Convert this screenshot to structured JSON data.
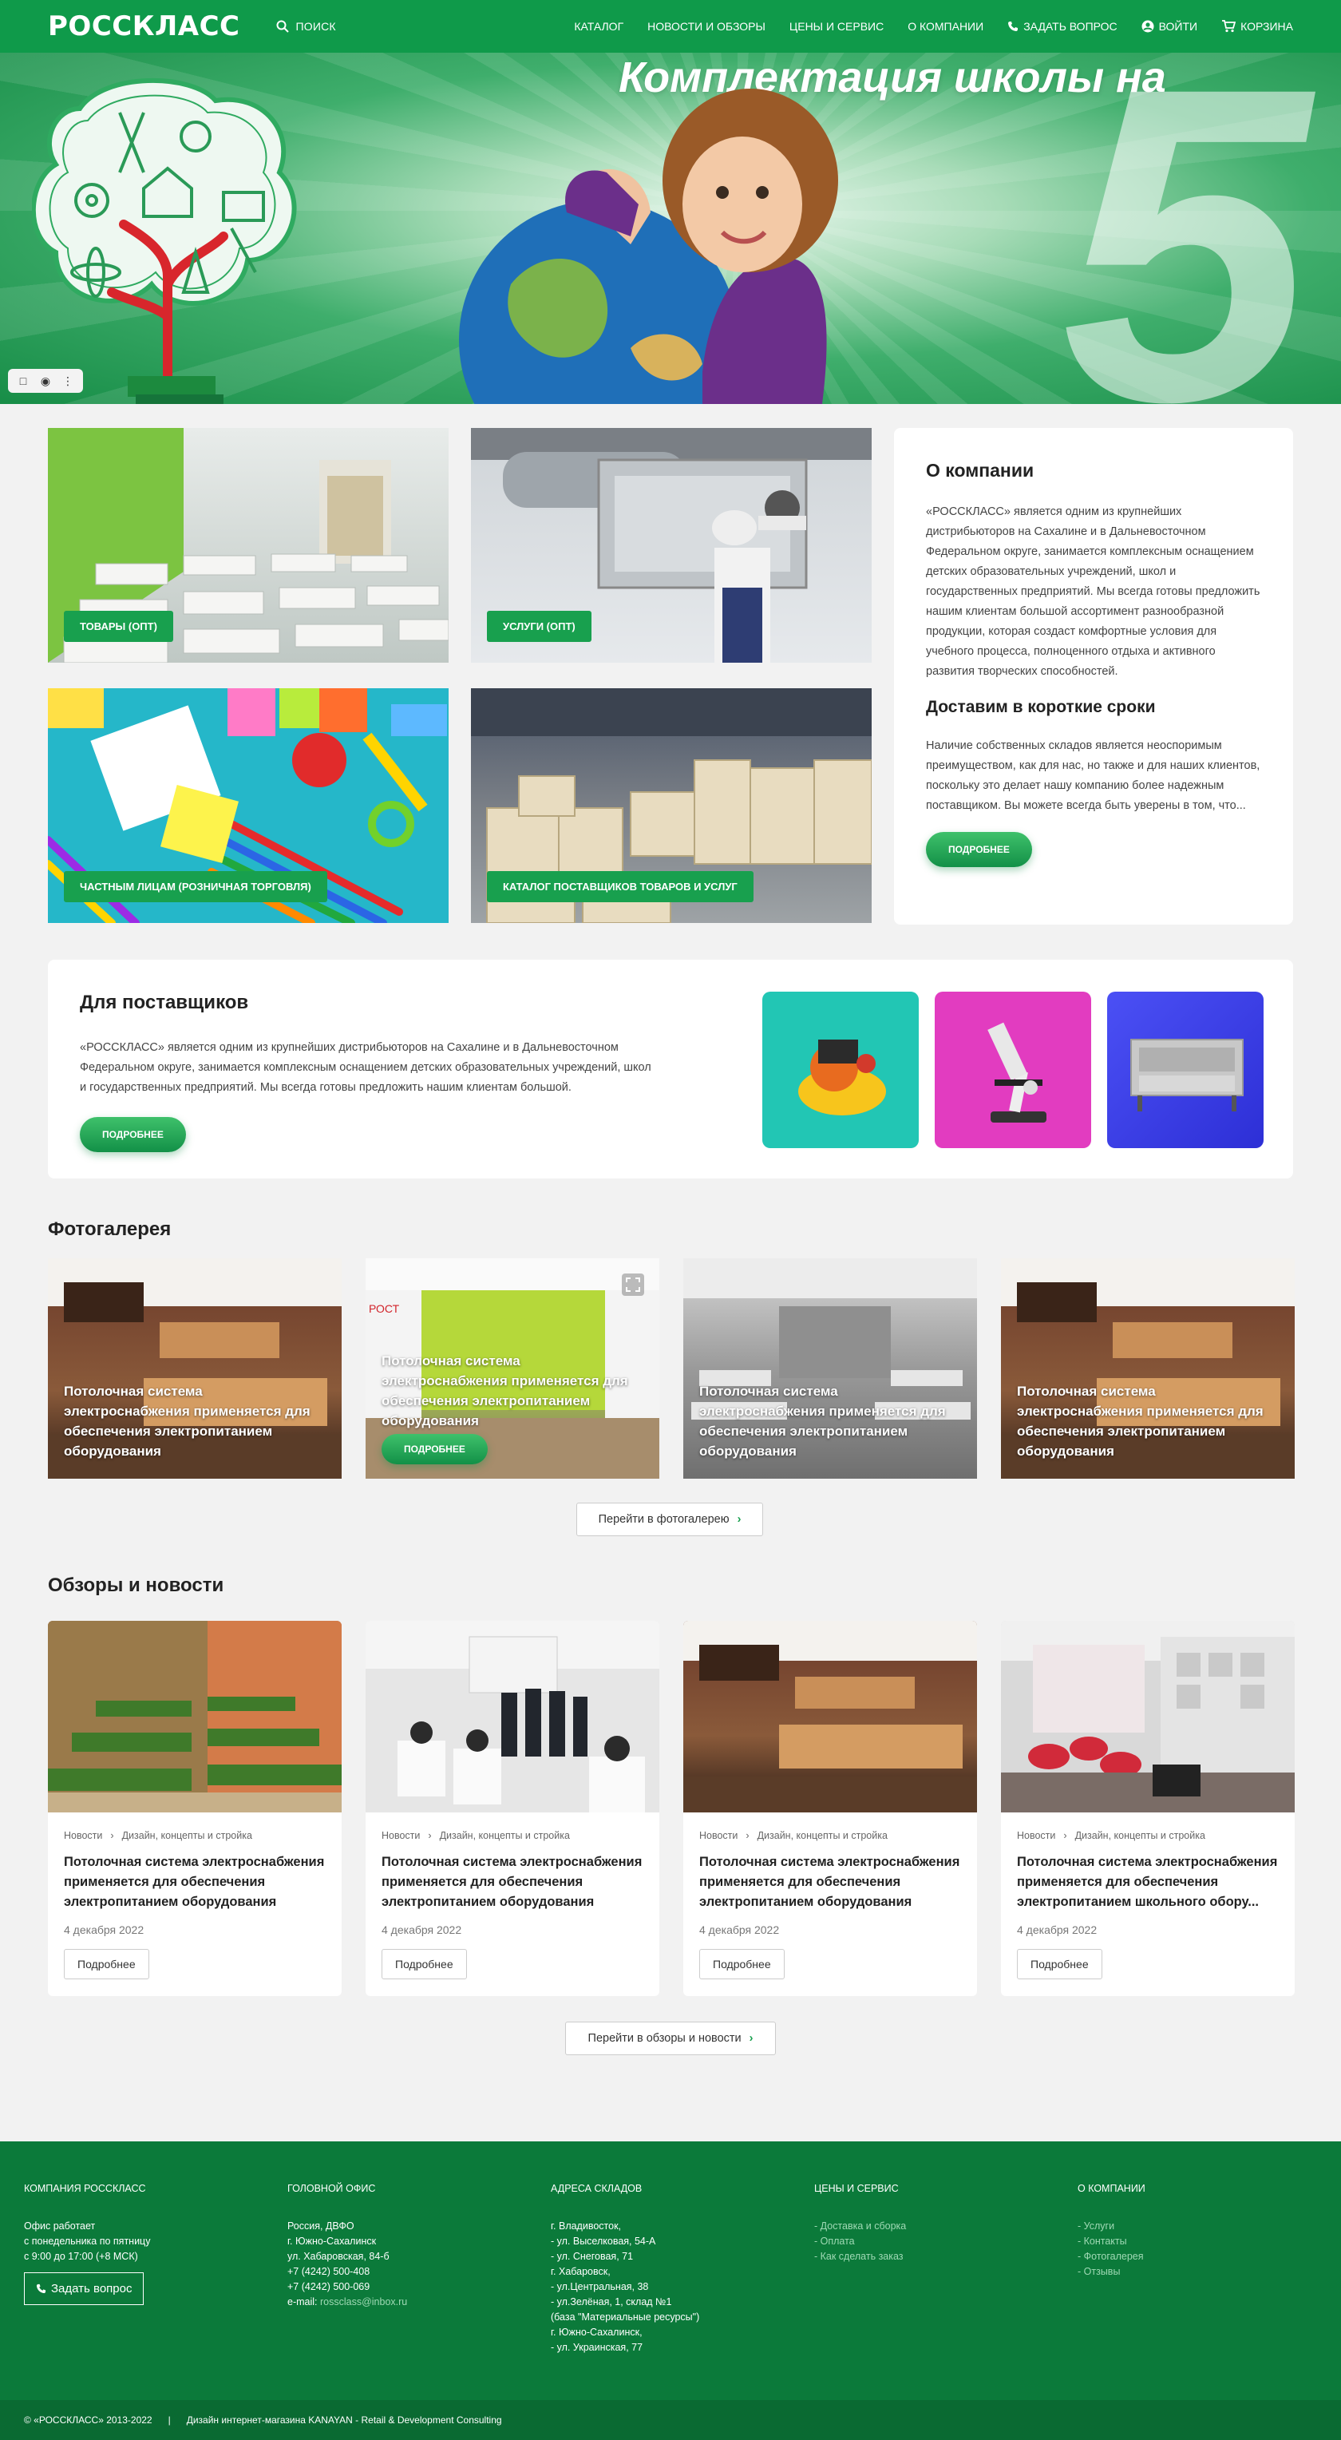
{
  "header": {
    "logo": "РОССКЛАСС",
    "search_label": "ПОИСК",
    "nav": [
      "КАТАЛОГ",
      "НОВОСТИ И ОБЗОРЫ",
      "ЦЕНЫ И СЕРВИС",
      "О КОМПАНИИ",
      "ЗАДАТЬ ВОПРОС",
      "ВОЙТИ",
      "КОРЗИНА"
    ]
  },
  "hero": {
    "title": "Комплектация школы на",
    "five": "5"
  },
  "tiles": [
    {
      "label": "ТОВАРЫ (ОПТ)"
    },
    {
      "label": "УСЛУГИ (ОПТ)"
    },
    {
      "label": "ЧАСТНЫМ ЛИЦАМ (РОЗНИЧНАЯ ТОРГОВЛЯ)"
    },
    {
      "label": "КАТАЛОГ ПОСТАВЩИКОВ ТОВАРОВ И УСЛУГ"
    }
  ],
  "about": {
    "title": "О компании",
    "text": "«РОССКЛАСС» является одним из крупнейших дистрибьюторов на Сахалине и в Дальневосточном Федеральном округе, занимается комплексным оснащением детских образовательных учреждений, школ и государственных предприятий. Мы всегда готовы предложить нашим клиентам большой ассортимент разнообразной продукции, которая создаст комфортные условия для учебного процесса, полноценного отдыха и активного развития творческих способностей.",
    "subtitle": "Доставим в короткие сроки",
    "text2": "Наличие собственных складов является неоспоримым преимуществом, как для нас, но также и для наших клиентов, поскольку это делает нашу компанию более надежным поставщиком. Вы можете всегда быть уверены в том, что...",
    "button": "ПОДРОБНЕЕ"
  },
  "suppliers": {
    "title": "Для поставщиков",
    "text": "«РОССКЛАСС» является одним из крупнейших дистрибьюторов на Сахалине и в Дальневосточном Федеральном округе, занимается комплексным оснащением детских образовательных учреждений, школ и государственных предприятий. Мы всегда готовы предложить нашим клиентам большой.",
    "button": "ПОДРОБНЕЕ",
    "colors": [
      "#22c6b4",
      "#e23cc0",
      "#3a3ff0"
    ]
  },
  "gallery": {
    "title": "Фотогалерея",
    "items": [
      {
        "caption": "Потолочная система электроснабжения применяется для обеспечения электропитанием оборудования"
      },
      {
        "caption": "Потолочная система электроснабжения применяется для обеспечения электропитанием оборудования",
        "button": "ПОДРОБНЕЕ"
      },
      {
        "caption": "Потолочная система электроснабжения применяется для обеспечения электропитанием оборудования"
      },
      {
        "caption": "Потолочная система электроснабжения применяется для обеспечения электропитанием оборудования"
      }
    ],
    "link": "Перейти в фотогалерею"
  },
  "news": {
    "title": "Обзоры и новости",
    "items": [
      {
        "crumb1": "Новости",
        "crumb2": "Дизайн, концепты и стройка",
        "title": "Потолочная система электроснабжения применяется для обеспечения электропитанием оборудования",
        "date": "4 декабря 2022",
        "button": "Подробнее"
      },
      {
        "crumb1": "Новости",
        "crumb2": "Дизайн, концепты и стройка",
        "title": "Потолочная система электроснабжения применяется для обеспечения электропитанием оборудования",
        "date": "4 декабря 2022",
        "button": "Подробнее"
      },
      {
        "crumb1": "Новости",
        "crumb2": "Дизайн, концепты и стройка",
        "title": "Потолочная система электроснабжения применяется для обеспечения электропитанием оборудования",
        "date": "4 декабря 2022",
        "button": "Подробнее"
      },
      {
        "crumb1": "Новости",
        "crumb2": "Дизайн, концепты и стройка",
        "title": "Потолочная система электроснабжения применяется для обеспечения электропитанием школьного обору...",
        "date": "4 декабря 2022",
        "button": "Подробнее"
      }
    ],
    "link": "Перейти в обзоры и новости"
  },
  "footer": {
    "col1_title": "КОМПАНИЯ РОССКЛАСС",
    "col1_lines": [
      "Офис работает",
      "с понедельника по пятницу",
      "с 9:00 до 17:00 (+8 МСК)"
    ],
    "ask_button": "Задать вопрос",
    "col2_title": "ГОЛОВНОЙ ОФИС",
    "col2_lines": [
      "Россия, ДВФО",
      "г. Южно-Сахалинск",
      "ул. Хабаровская, 84-б",
      "+7 (4242) 500-408",
      "+7 (4242) 500-069"
    ],
    "email_label": "e-mail:",
    "email": "rossclass@inbox.ru",
    "col3_title": "АДРЕСА СКЛАДОВ",
    "col3_lines": [
      "г. Владивосток,",
      "- ул. Выселковая, 54-А",
      "- ул. Снеговая, 71",
      "г. Хабаровск,",
      "- ул.Центральная, 38",
      "- ул.Зелёная, 1, склад №1",
      "(база \"Материальные ресурсы\")",
      "г. Южно-Сахалинск,",
      "- ул. Украинская, 77"
    ],
    "col4_title": "ЦЕНЫ И СЕРВИС",
    "col4_lines": [
      "- Доставка и сборка",
      "- Оплата",
      "- Как сделать заказ"
    ],
    "col5_title": "О КОМПАНИИ",
    "col5_lines": [
      "- Услуги",
      "- Контакты",
      "- Фотогалерея",
      "- Отзывы"
    ],
    "copyright": "© «РОССКЛАСС» 2013-2022",
    "separator": "|",
    "credits": "Дизайн интернет-магазина KANAYAN - Retail & Development Consulting"
  }
}
